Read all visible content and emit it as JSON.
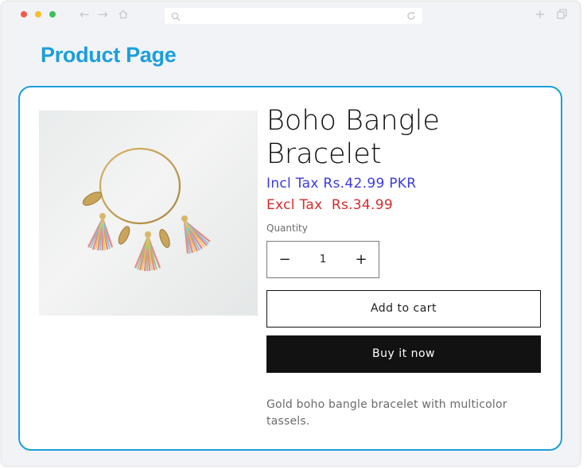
{
  "browser": {
    "traffic_lights": {
      "close": "#f25a4b",
      "minimize": "#f6bf30",
      "maximize": "#3fbf55"
    },
    "icons": [
      "back-arrow-icon",
      "forward-arrow-icon",
      "home-icon",
      "search-icon",
      "reload-icon",
      "new-tab-icon",
      "tabs-icon"
    ],
    "url": ""
  },
  "page": {
    "title": "Product Page",
    "accent_color": "#1a9fdb"
  },
  "product": {
    "image_alt": "bracelet-image",
    "title": "Boho Bangle Bracelet",
    "price_incl": "Incl Tax Rs.42.99 PKR",
    "price_excl": "Excl Tax  Rs.34.99",
    "price_incl_color": "#3b3bde",
    "price_excl_color": "#d62b2b",
    "quantity_label": "Quantity",
    "quantity_value": "1",
    "decrease_symbol": "−",
    "increase_symbol": "+",
    "add_to_cart_label": "Add to cart",
    "buy_now_label": "Buy it now",
    "description": "Gold boho bangle bracelet with multicolor tassels."
  }
}
